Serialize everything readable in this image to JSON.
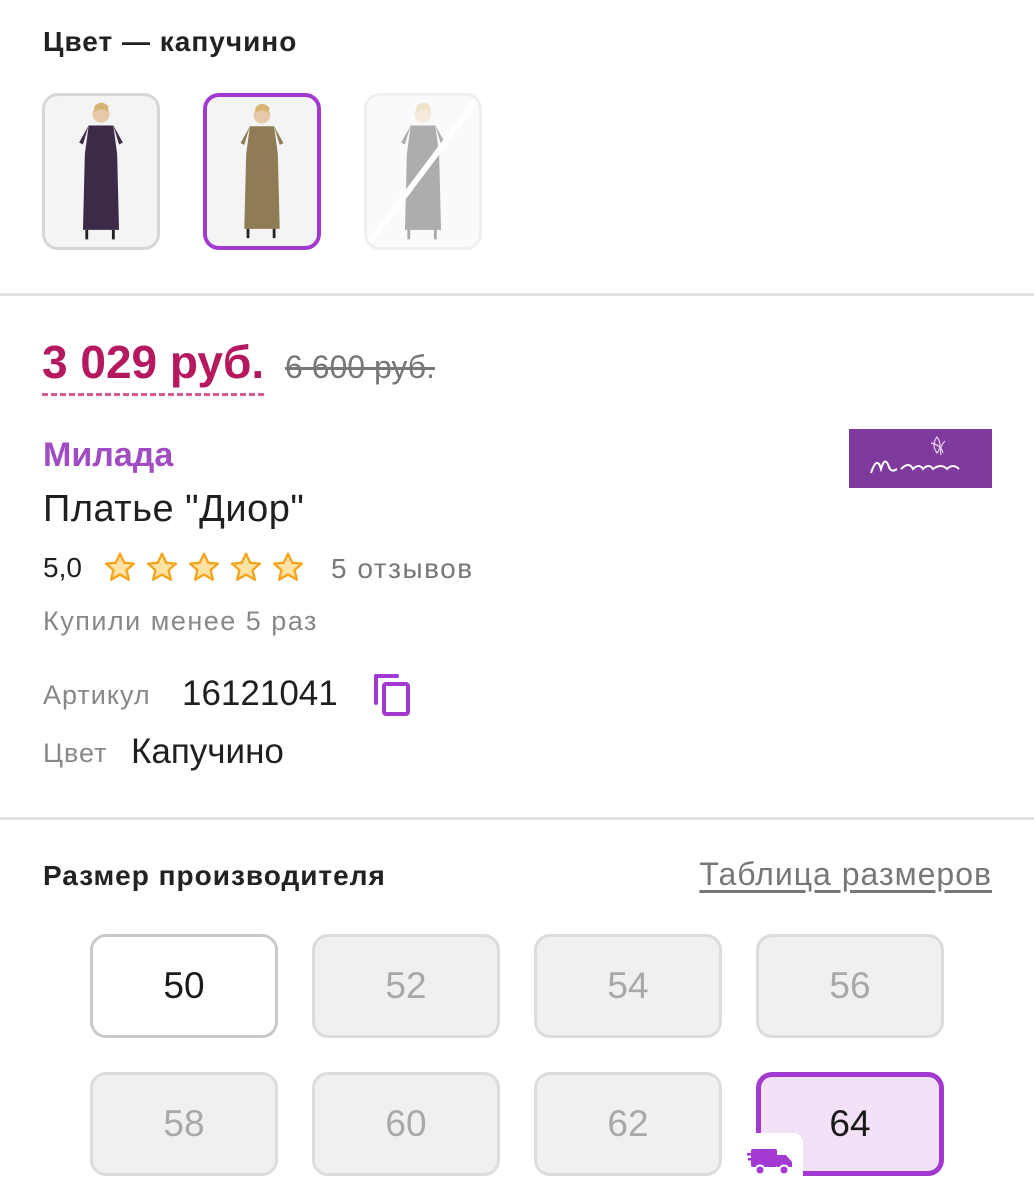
{
  "color_section": {
    "heading": "Цвет — капучино",
    "swatches": [
      {
        "name": "dark-purple",
        "dress_color": "#3d2a48",
        "state": "available"
      },
      {
        "name": "cappuccino",
        "dress_color": "#8f7c55",
        "state": "selected"
      },
      {
        "name": "black",
        "dress_color": "#2a2a2a",
        "state": "unavailable"
      }
    ]
  },
  "pricing": {
    "price": "3 029 руб.",
    "old_price": "6 600 руб."
  },
  "product": {
    "brand": "Милада",
    "brand_logo_color": "#7f3a9e",
    "title": "Платье \"Диор\"",
    "rating": "5,0",
    "stars": 5,
    "reviews": "5 отзывов",
    "bought": "Купили менее 5 раз",
    "article_label": "Артикул",
    "article_value": "16121041",
    "color_label": "Цвет",
    "color_value": "Капучино"
  },
  "sizes": {
    "heading": "Размер производителя",
    "table_link": "Таблица размеров",
    "items": [
      {
        "label": "50",
        "state": "available"
      },
      {
        "label": "52",
        "state": "unavailable"
      },
      {
        "label": "54",
        "state": "unavailable"
      },
      {
        "label": "56",
        "state": "unavailable"
      },
      {
        "label": "58",
        "state": "unavailable"
      },
      {
        "label": "60",
        "state": "unavailable"
      },
      {
        "label": "62",
        "state": "unavailable"
      },
      {
        "label": "64",
        "state": "selected"
      }
    ]
  },
  "colors": {
    "accent": "#a23ad1",
    "price": "#b5185f",
    "brand": "#a04cc2",
    "star": "#f2a51f"
  }
}
